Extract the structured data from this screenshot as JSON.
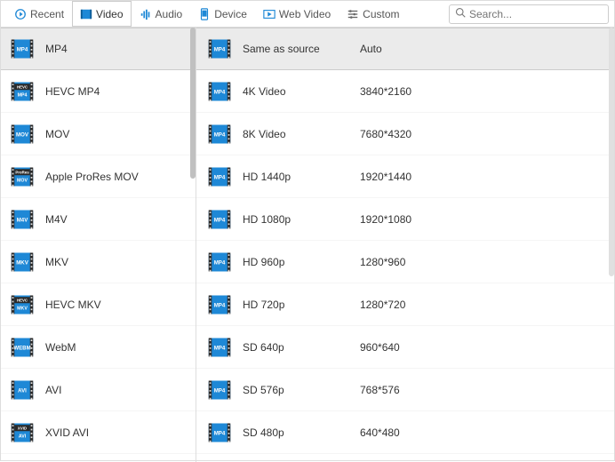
{
  "tabs": [
    {
      "id": "recent",
      "label": "Recent"
    },
    {
      "id": "video",
      "label": "Video"
    },
    {
      "id": "audio",
      "label": "Audio"
    },
    {
      "id": "device",
      "label": "Device"
    },
    {
      "id": "webvideo",
      "label": "Web Video"
    },
    {
      "id": "custom",
      "label": "Custom"
    }
  ],
  "active_tab": "video",
  "search": {
    "placeholder": "Search..."
  },
  "formats": [
    {
      "label": "MP4",
      "icon": "MP4",
      "selected": true
    },
    {
      "label": "HEVC MP4",
      "icon": "HEVC"
    },
    {
      "label": "MOV",
      "icon": "MOV"
    },
    {
      "label": "Apple ProRes MOV",
      "icon": "ProRes"
    },
    {
      "label": "M4V",
      "icon": "M4V"
    },
    {
      "label": "MKV",
      "icon": "MKV"
    },
    {
      "label": "HEVC MKV",
      "icon": "HEVC_MKV"
    },
    {
      "label": "WebM",
      "icon": "WEBM"
    },
    {
      "label": "AVI",
      "icon": "AVI"
    },
    {
      "label": "XVID AVI",
      "icon": "XVID"
    }
  ],
  "presets": [
    {
      "name": "Same as source",
      "resolution": "Auto",
      "selected": true
    },
    {
      "name": "4K Video",
      "resolution": "3840*2160"
    },
    {
      "name": "8K Video",
      "resolution": "7680*4320"
    },
    {
      "name": "HD 1440p",
      "resolution": "1920*1440"
    },
    {
      "name": "HD 1080p",
      "resolution": "1920*1080"
    },
    {
      "name": "HD 960p",
      "resolution": "1280*960"
    },
    {
      "name": "HD 720p",
      "resolution": "1280*720"
    },
    {
      "name": "SD 640p",
      "resolution": "960*640"
    },
    {
      "name": "SD 576p",
      "resolution": "768*576"
    },
    {
      "name": "SD 480p",
      "resolution": "640*480"
    }
  ],
  "icons": {
    "accent": "#1e88d6",
    "dark": "#2a2a2a"
  }
}
